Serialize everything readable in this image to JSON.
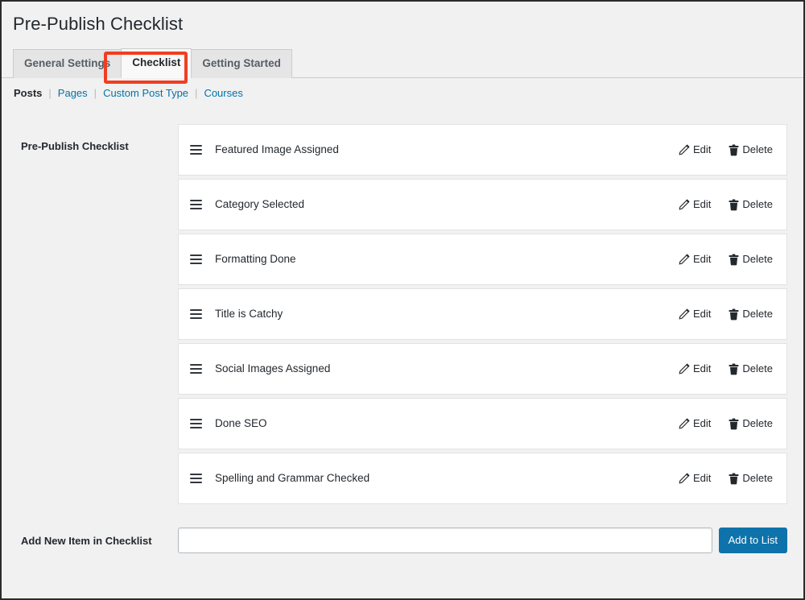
{
  "page": {
    "title": "Pre-Publish Checklist"
  },
  "tabs": [
    {
      "label": "General Settings",
      "active": false
    },
    {
      "label": "Checklist",
      "active": true
    },
    {
      "label": "Getting Started",
      "active": false
    }
  ],
  "subnav": [
    {
      "label": "Posts",
      "current": true
    },
    {
      "label": "Pages",
      "current": false
    },
    {
      "label": "Custom Post Type",
      "current": false
    },
    {
      "label": "Courses",
      "current": false
    }
  ],
  "checklist_section": {
    "label": "Pre-Publish Checklist",
    "items": [
      {
        "label": "Featured Image Assigned"
      },
      {
        "label": "Category Selected"
      },
      {
        "label": "Formatting Done"
      },
      {
        "label": "Title is Catchy"
      },
      {
        "label": "Social Images Assigned"
      },
      {
        "label": "Done SEO"
      },
      {
        "label": "Spelling and Grammar Checked"
      }
    ],
    "actions": {
      "edit_label": "Edit",
      "delete_label": "Delete",
      "edit_icon": "pencil-icon",
      "delete_icon": "trash-icon",
      "drag_icon": "drag-handle-icon"
    }
  },
  "add_item": {
    "label": "Add New Item in Checklist",
    "input_value": "",
    "input_placeholder": "",
    "button_label": "Add to List"
  },
  "colors": {
    "accent_blue": "#0e73aa",
    "link_blue": "#0073aa",
    "highlight_red": "#f03e22",
    "page_background": "#f1f1f1",
    "row_background": "#ffffff",
    "text": "#23282d"
  }
}
